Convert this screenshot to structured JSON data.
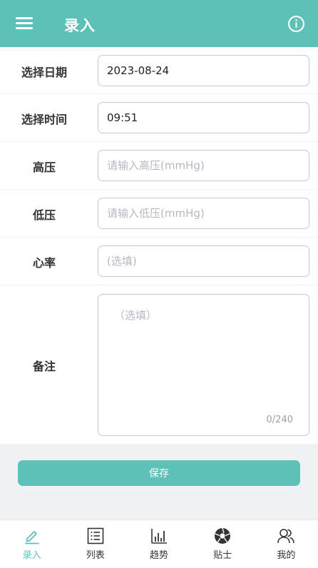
{
  "header": {
    "title": "录入",
    "menu_icon": "menu-icon",
    "info_icon": "info-icon"
  },
  "form": {
    "date": {
      "label": "选择日期",
      "value": "2023-08-24"
    },
    "time": {
      "label": "选择时间",
      "value": "09:51"
    },
    "systolic": {
      "label": "高压",
      "placeholder": "请输入高压(mmHg)"
    },
    "diastolic": {
      "label": "低压",
      "placeholder": "请输入低压(mmHg)"
    },
    "heart_rate": {
      "label": "心率",
      "placeholder": "(选填)"
    },
    "remark": {
      "label": "备注",
      "placeholder": "（选填）",
      "counter": "0/240"
    }
  },
  "save_label": "保存",
  "nav": {
    "items": [
      {
        "label": "录入",
        "icon": "pencil-icon",
        "active": true
      },
      {
        "label": "列表",
        "icon": "list-icon",
        "active": false
      },
      {
        "label": "趋势",
        "icon": "bar-chart-icon",
        "active": false
      },
      {
        "label": "贴士",
        "icon": "aperture-icon",
        "active": false
      },
      {
        "label": "我的",
        "icon": "users-icon",
        "active": false
      }
    ]
  },
  "colors": {
    "accent": "#5dc1b9",
    "background_band": "#eef2f5",
    "placeholder": "#b3b8c2"
  }
}
